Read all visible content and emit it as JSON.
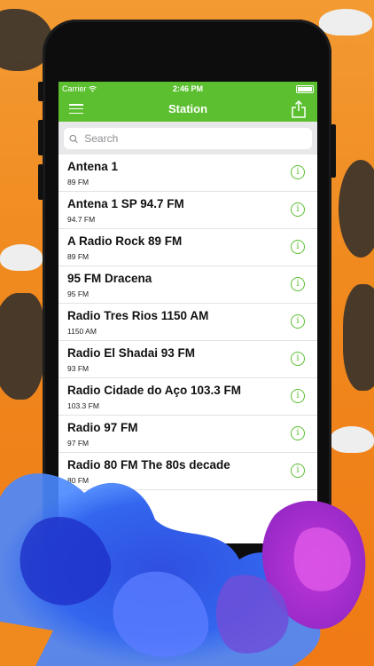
{
  "status_bar": {
    "carrier": "Carrier",
    "time": "2:46 PM"
  },
  "nav": {
    "title": "Station",
    "menu_icon": "hamburger-icon",
    "share_icon": "share-icon"
  },
  "search": {
    "placeholder": "Search",
    "value": ""
  },
  "stations": [
    {
      "name": "Antena 1",
      "frequency": "89 FM"
    },
    {
      "name": "Antena 1 SP 94.7 FM",
      "frequency": "94.7 FM"
    },
    {
      "name": "A Radio Rock 89 FM",
      "frequency": "89 FM"
    },
    {
      "name": "95 FM Dracena",
      "frequency": "95 FM"
    },
    {
      "name": "Radio Tres Rios 1150 AM",
      "frequency": "1150 AM"
    },
    {
      "name": "Radio El Shadai 93 FM",
      "frequency": "93 FM"
    },
    {
      "name": "Radio Cidade do Aço 103.3 FM",
      "frequency": "103.3 FM"
    },
    {
      "name": "Radio 97 FM",
      "frequency": "97 FM"
    },
    {
      "name": "Radio 80 FM The 80s decade",
      "frequency": "80 FM"
    }
  ],
  "colors": {
    "accent": "#5bbf2f",
    "background": "#f08a1f"
  }
}
